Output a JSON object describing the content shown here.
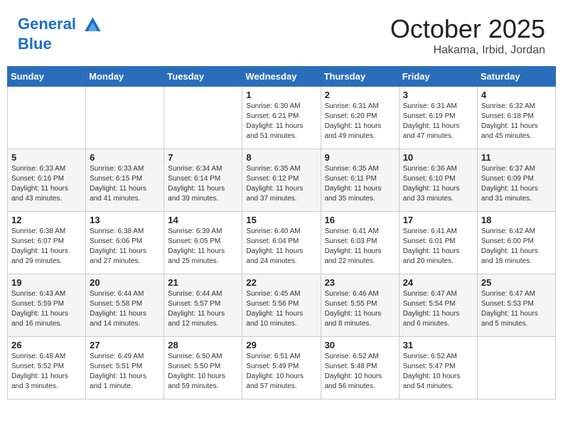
{
  "header": {
    "logo_line1": "General",
    "logo_line2": "Blue",
    "month": "October 2025",
    "location": "Hakama, Irbid, Jordan"
  },
  "weekdays": [
    "Sunday",
    "Monday",
    "Tuesday",
    "Wednesday",
    "Thursday",
    "Friday",
    "Saturday"
  ],
  "weeks": [
    [
      {
        "day": "",
        "info": ""
      },
      {
        "day": "",
        "info": ""
      },
      {
        "day": "",
        "info": ""
      },
      {
        "day": "1",
        "info": "Sunrise: 6:30 AM\nSunset: 6:21 PM\nDaylight: 11 hours\nand 51 minutes."
      },
      {
        "day": "2",
        "info": "Sunrise: 6:31 AM\nSunset: 6:20 PM\nDaylight: 11 hours\nand 49 minutes."
      },
      {
        "day": "3",
        "info": "Sunrise: 6:31 AM\nSunset: 6:19 PM\nDaylight: 11 hours\nand 47 minutes."
      },
      {
        "day": "4",
        "info": "Sunrise: 6:32 AM\nSunset: 6:18 PM\nDaylight: 11 hours\nand 45 minutes."
      }
    ],
    [
      {
        "day": "5",
        "info": "Sunrise: 6:33 AM\nSunset: 6:16 PM\nDaylight: 11 hours\nand 43 minutes."
      },
      {
        "day": "6",
        "info": "Sunrise: 6:33 AM\nSunset: 6:15 PM\nDaylight: 11 hours\nand 41 minutes."
      },
      {
        "day": "7",
        "info": "Sunrise: 6:34 AM\nSunset: 6:14 PM\nDaylight: 11 hours\nand 39 minutes."
      },
      {
        "day": "8",
        "info": "Sunrise: 6:35 AM\nSunset: 6:12 PM\nDaylight: 11 hours\nand 37 minutes."
      },
      {
        "day": "9",
        "info": "Sunrise: 6:35 AM\nSunset: 6:11 PM\nDaylight: 11 hours\nand 35 minutes."
      },
      {
        "day": "10",
        "info": "Sunrise: 6:36 AM\nSunset: 6:10 PM\nDaylight: 11 hours\nand 33 minutes."
      },
      {
        "day": "11",
        "info": "Sunrise: 6:37 AM\nSunset: 6:09 PM\nDaylight: 11 hours\nand 31 minutes."
      }
    ],
    [
      {
        "day": "12",
        "info": "Sunrise: 6:38 AM\nSunset: 6:07 PM\nDaylight: 11 hours\nand 29 minutes."
      },
      {
        "day": "13",
        "info": "Sunrise: 6:38 AM\nSunset: 6:06 PM\nDaylight: 11 hours\nand 27 minutes."
      },
      {
        "day": "14",
        "info": "Sunrise: 6:39 AM\nSunset: 6:05 PM\nDaylight: 11 hours\nand 25 minutes."
      },
      {
        "day": "15",
        "info": "Sunrise: 6:40 AM\nSunset: 6:04 PM\nDaylight: 11 hours\nand 24 minutes."
      },
      {
        "day": "16",
        "info": "Sunrise: 6:41 AM\nSunset: 6:03 PM\nDaylight: 11 hours\nand 22 minutes."
      },
      {
        "day": "17",
        "info": "Sunrise: 6:41 AM\nSunset: 6:01 PM\nDaylight: 11 hours\nand 20 minutes."
      },
      {
        "day": "18",
        "info": "Sunrise: 6:42 AM\nSunset: 6:00 PM\nDaylight: 11 hours\nand 18 minutes."
      }
    ],
    [
      {
        "day": "19",
        "info": "Sunrise: 6:43 AM\nSunset: 5:59 PM\nDaylight: 11 hours\nand 16 minutes."
      },
      {
        "day": "20",
        "info": "Sunrise: 6:44 AM\nSunset: 5:58 PM\nDaylight: 11 hours\nand 14 minutes."
      },
      {
        "day": "21",
        "info": "Sunrise: 6:44 AM\nSunset: 5:57 PM\nDaylight: 11 hours\nand 12 minutes."
      },
      {
        "day": "22",
        "info": "Sunrise: 6:45 AM\nSunset: 5:56 PM\nDaylight: 11 hours\nand 10 minutes."
      },
      {
        "day": "23",
        "info": "Sunrise: 6:46 AM\nSunset: 5:55 PM\nDaylight: 11 hours\nand 8 minutes."
      },
      {
        "day": "24",
        "info": "Sunrise: 6:47 AM\nSunset: 5:54 PM\nDaylight: 11 hours\nand 6 minutes."
      },
      {
        "day": "25",
        "info": "Sunrise: 6:47 AM\nSunset: 5:53 PM\nDaylight: 11 hours\nand 5 minutes."
      }
    ],
    [
      {
        "day": "26",
        "info": "Sunrise: 6:48 AM\nSunset: 5:52 PM\nDaylight: 11 hours\nand 3 minutes."
      },
      {
        "day": "27",
        "info": "Sunrise: 6:49 AM\nSunset: 5:51 PM\nDaylight: 11 hours\nand 1 minute."
      },
      {
        "day": "28",
        "info": "Sunrise: 6:50 AM\nSunset: 5:50 PM\nDaylight: 10 hours\nand 59 minutes."
      },
      {
        "day": "29",
        "info": "Sunrise: 6:51 AM\nSunset: 5:49 PM\nDaylight: 10 hours\nand 57 minutes."
      },
      {
        "day": "30",
        "info": "Sunrise: 6:52 AM\nSunset: 5:48 PM\nDaylight: 10 hours\nand 56 minutes."
      },
      {
        "day": "31",
        "info": "Sunrise: 6:52 AM\nSunset: 5:47 PM\nDaylight: 10 hours\nand 54 minutes."
      },
      {
        "day": "",
        "info": ""
      }
    ]
  ]
}
